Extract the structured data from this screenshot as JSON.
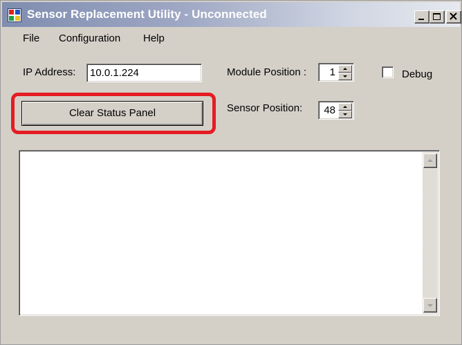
{
  "window": {
    "title": "Sensor Replacement Utility - Unconnected",
    "icon": "app-window-icon",
    "title_color": "#ffffff",
    "highlight_color": "#e51c23"
  },
  "menu": {
    "items": [
      {
        "label": "File"
      },
      {
        "label": "Configuration"
      },
      {
        "label": "Help"
      }
    ]
  },
  "form": {
    "ip_label": "IP Address:",
    "ip_value": "10.0.1.224",
    "module_label": "Module Position :",
    "module_value": "1",
    "sensor_label": "Sensor Position:",
    "sensor_value": "48",
    "debug_label": "Debug",
    "debug_checked": false
  },
  "buttons": {
    "clear_status": "Clear Status Panel"
  },
  "status_panel": {
    "content": ""
  }
}
